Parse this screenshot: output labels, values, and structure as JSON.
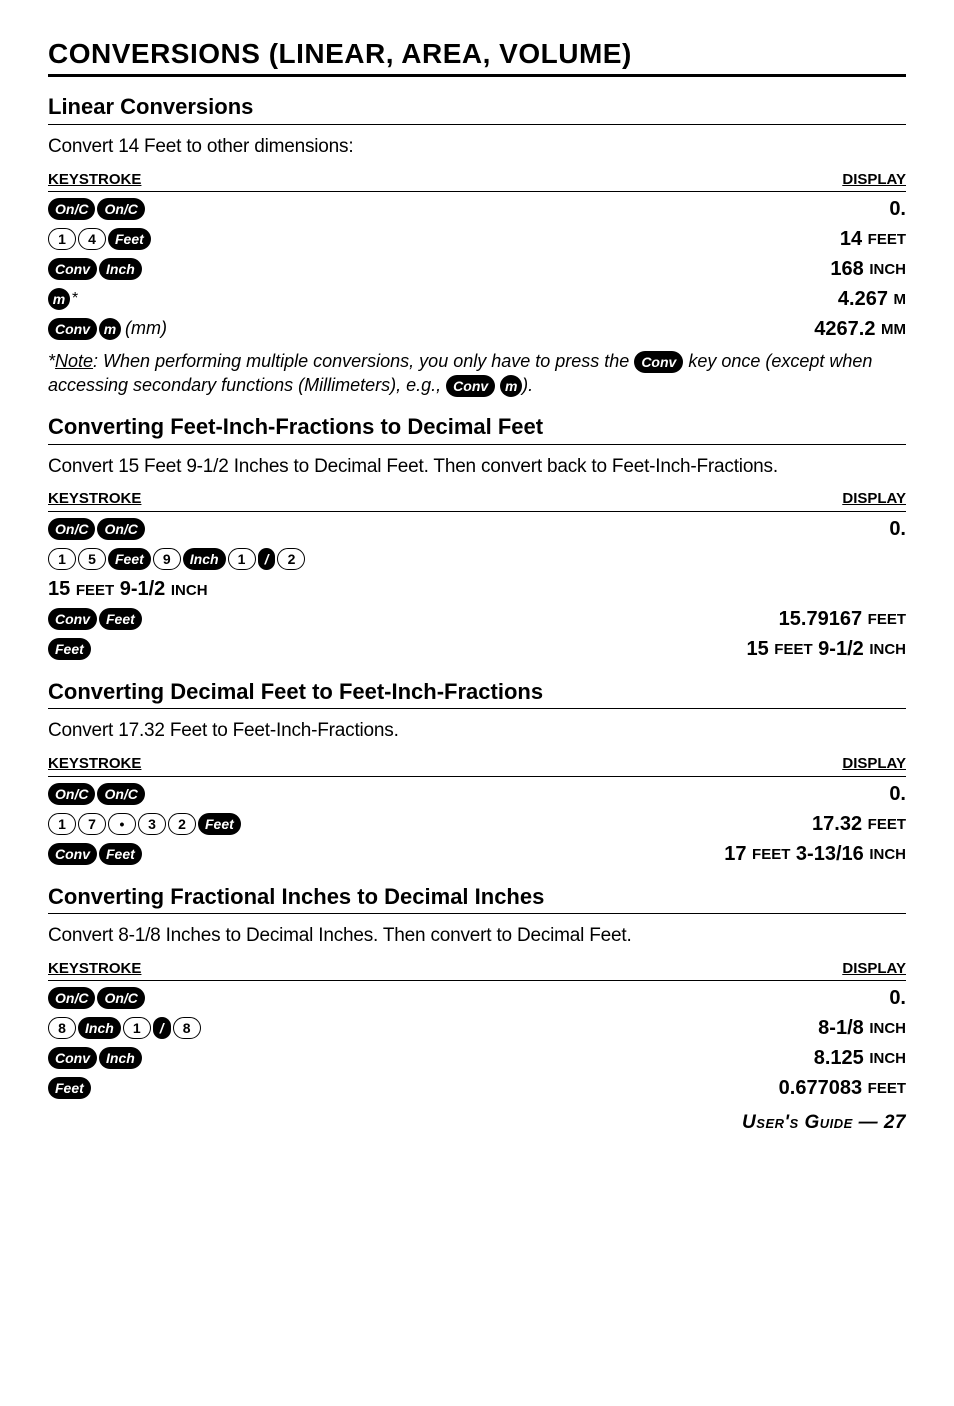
{
  "title": "CONVERSIONS (LINEAR, AREA, VOLUME)",
  "section1": {
    "heading": "Linear Conversions",
    "intro": "Convert 14 Feet to other dimensions:",
    "header_left": "KEYSTROKE",
    "header_right": "DISPLAY",
    "rows": {
      "r1_disp": "0.",
      "r2_disp_num": "14 ",
      "r2_disp_unit": "FEET",
      "r3_disp_num": "168 ",
      "r3_disp_unit": "INCH",
      "r4_disp_num": "4.267 ",
      "r4_disp_unit": "M",
      "r5_disp_num": "4267.2 ",
      "r5_disp_unit": "MM",
      "mm_label": "(mm)"
    },
    "note_prefix": "Note",
    "note_body1": ": When performing multiple conversions, you only have to press the ",
    "note_body2": " key once (except when accessing secondary functions (Millimeters), e.g., ",
    "note_body3": ")."
  },
  "section2": {
    "heading": "Converting Feet-Inch-Fractions to Decimal Feet",
    "intro": "Convert 15 Feet 9-1/2 Inches to Decimal Feet. Then convert back to Feet-Inch-Fractions.",
    "header_left": "KEYSTROKE",
    "header_right": "DISPLAY",
    "r1_disp": "0.",
    "after_num": "15 ",
    "after_unit1": "FEET",
    "after_mid": " 9-1/2 ",
    "after_unit2": "INCH",
    "r3_num": "15.79167 ",
    "r3_unit": "FEET",
    "r4_num1": "15 ",
    "r4_unit1": "FEET",
    "r4_num2": " 9-1/2 ",
    "r4_unit2": "INCH"
  },
  "section3": {
    "heading": "Converting Decimal Feet to Feet-Inch-Fractions",
    "intro": "Convert 17.32 Feet to Feet-Inch-Fractions.",
    "header_left": "KEYSTROKE",
    "header_right": "DISPLAY",
    "r1_disp": "0.",
    "r2_num": "17.32 ",
    "r2_unit": "FEET",
    "r3_num1": "17 ",
    "r3_unit1": "FEET",
    "r3_num2": " 3-13/16 ",
    "r3_unit2": "INCH"
  },
  "section4": {
    "heading": "Converting Fractional Inches to Decimal Inches",
    "intro": "Convert 8-1/8 Inches to Decimal Inches. Then convert to Decimal Feet.",
    "header_left": "KEYSTROKE",
    "header_right": "DISPLAY",
    "r1_disp": "0.",
    "r2_num": "8-1/8 ",
    "r2_unit": "INCH",
    "r3_num": "8.125 ",
    "r3_unit": "INCH",
    "r4_num": "0.677083 ",
    "r4_unit": "FEET"
  },
  "keys": {
    "onc": "On/C",
    "feet": "Feet",
    "conv": "Conv",
    "inch": "Inch",
    "m": "m",
    "d1": "1",
    "d2": "2",
    "d3": "3",
    "d4": "4",
    "d5": "5",
    "d7": "7",
    "d8": "8",
    "d9": "9",
    "slash": "/",
    "dot": "•"
  },
  "footer": "User's Guide — 27"
}
